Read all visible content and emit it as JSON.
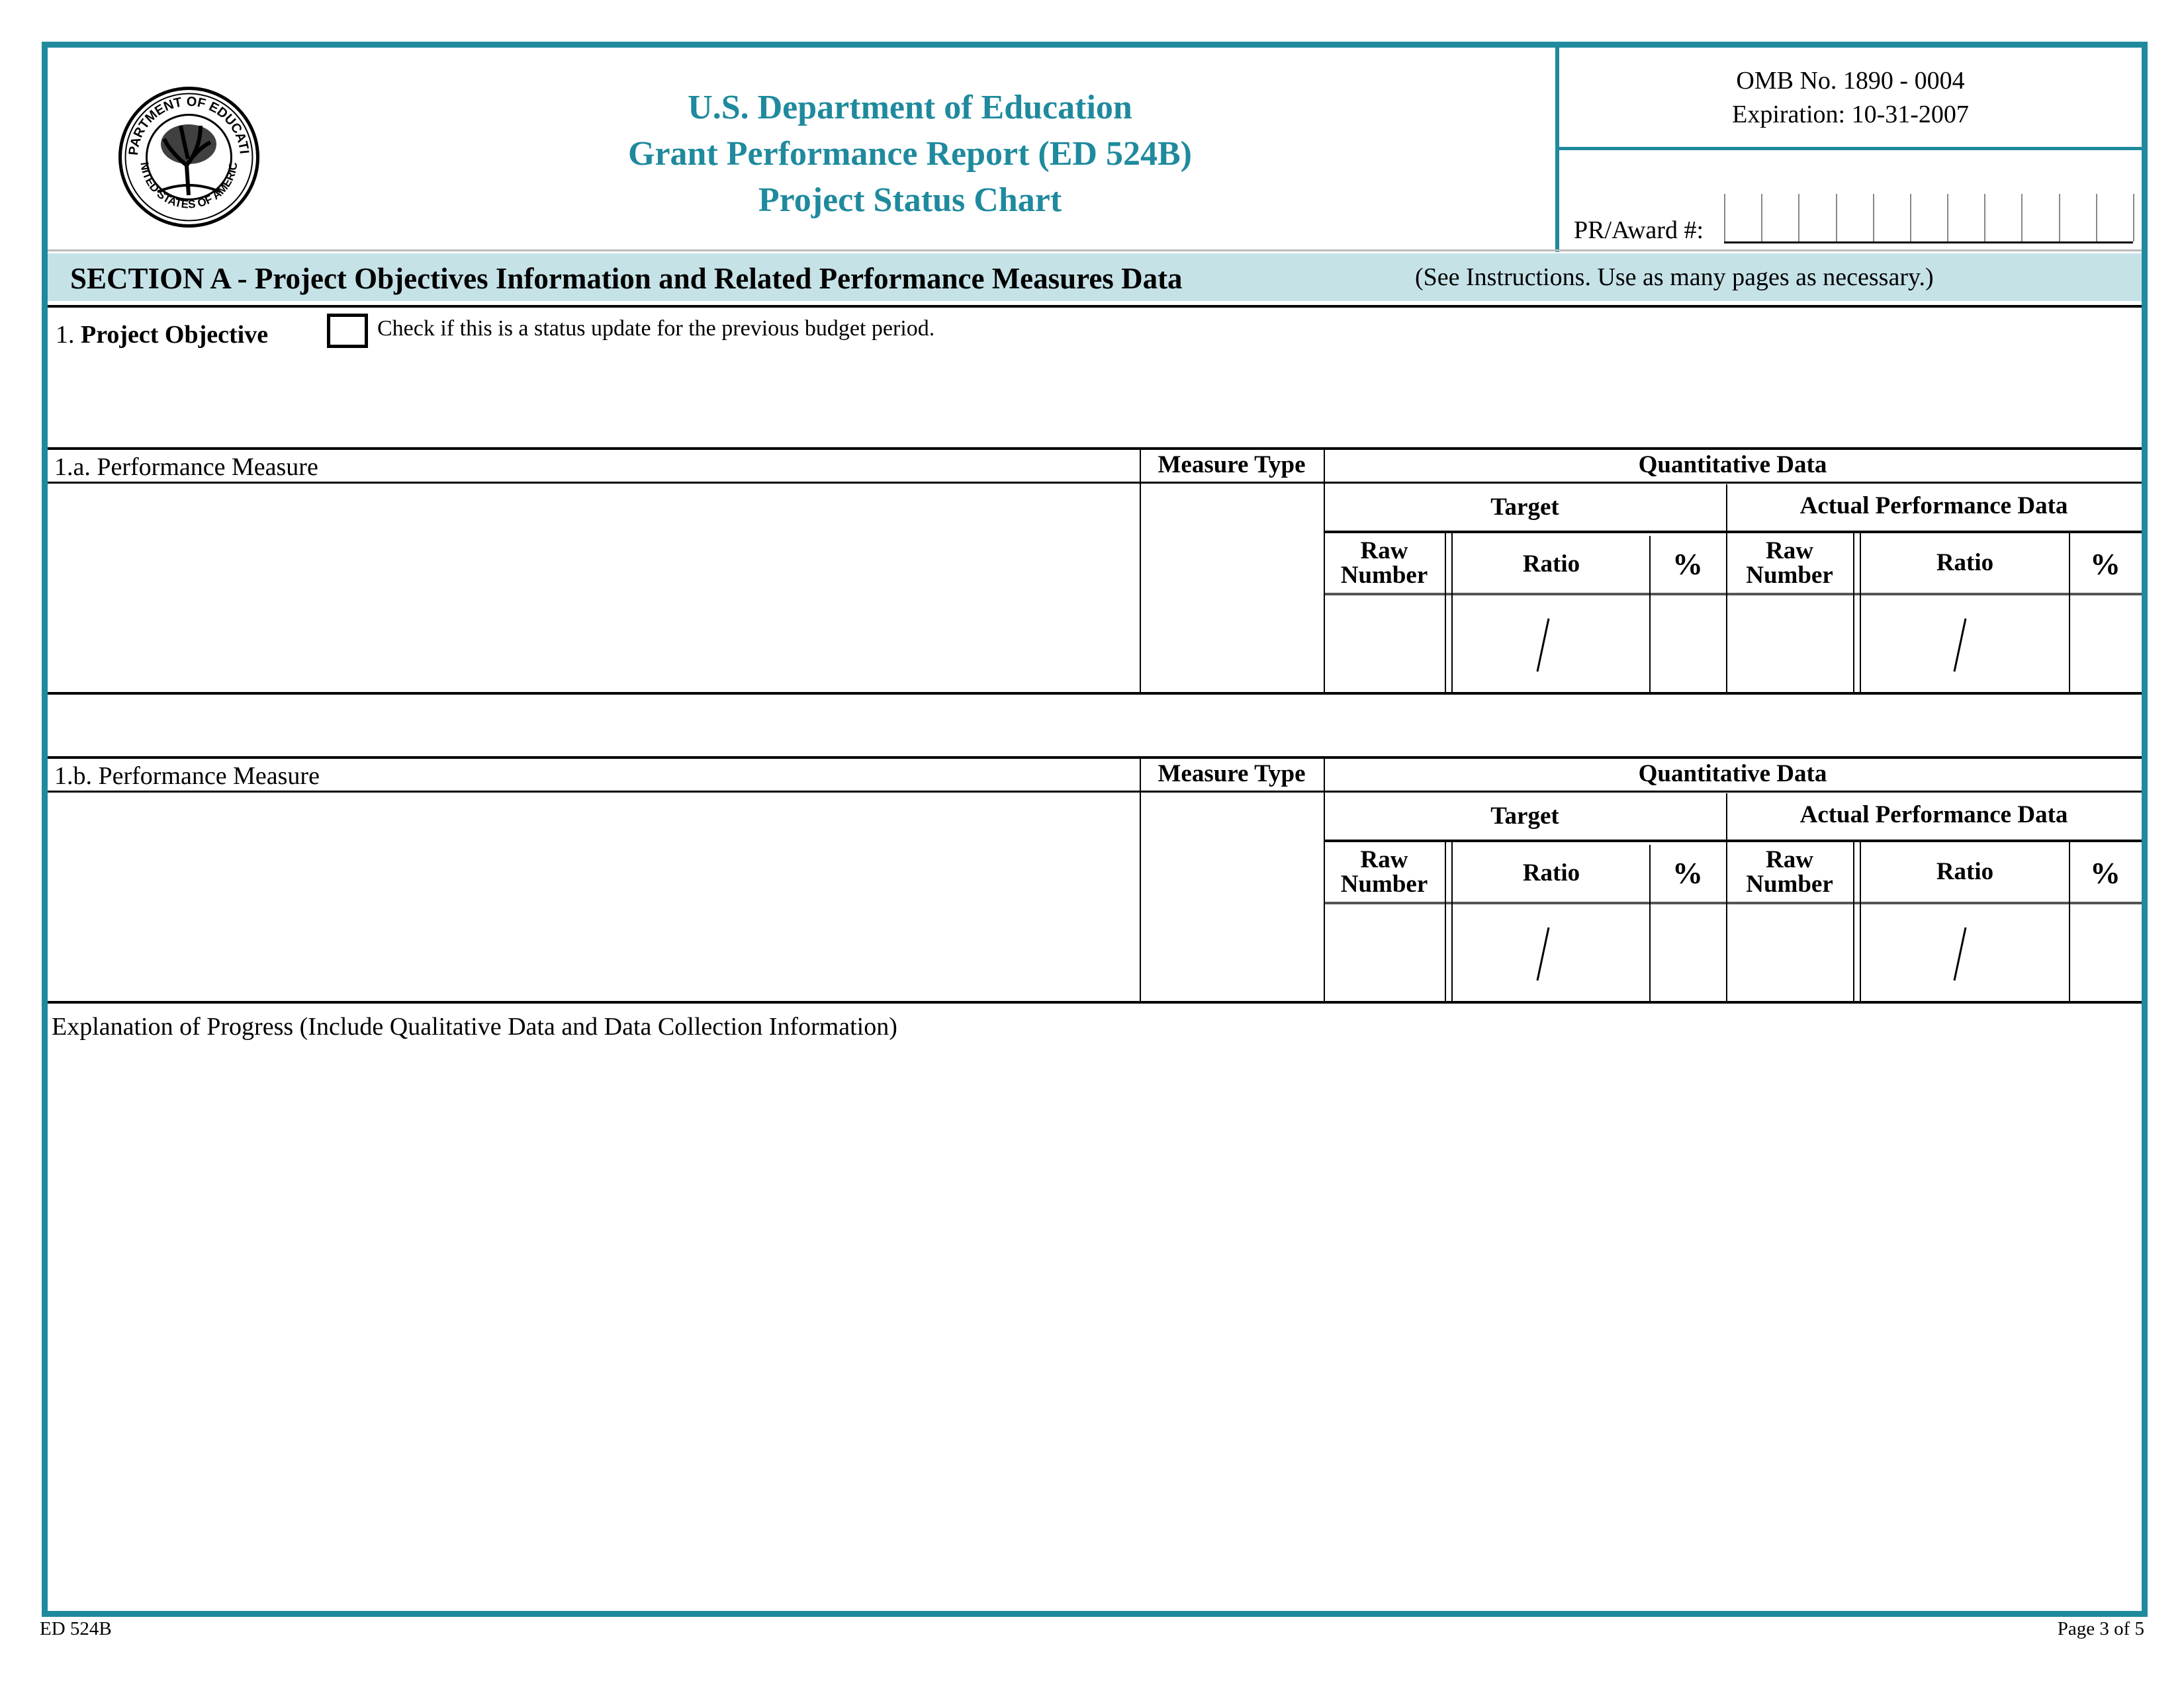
{
  "header": {
    "agency": "U.S. Department of Education",
    "report_title": "Grant Performance Report (ED 524B)",
    "chart_title": "Project Status Chart",
    "seal_icon": "department-of-education-seal",
    "omb_number": "OMB No. 1890 - 0004",
    "expiration": "Expiration: 10-31-2007",
    "award_label": "PR/Award #:",
    "award_cells": 11,
    "award_value": ""
  },
  "section_a": {
    "title": "SECTION A - Project Objectives Information and Related Performance Measures Data",
    "note": "(See Instructions.  Use as many pages as necessary.)"
  },
  "objective": {
    "number": "1.",
    "label": "Project Objective",
    "checkbox_label": "Check if this is a status update for the previous budget period.",
    "checked": false,
    "value": ""
  },
  "measures": [
    {
      "label": "1.a. Performance Measure",
      "measure_type_header": "Measure Type",
      "quantitative_header": "Quantitative Data",
      "target_header": "Target",
      "actual_header": "Actual Performance Data",
      "columns": [
        "Raw Number",
        "Ratio",
        "%",
        "Raw Number",
        "Ratio",
        "%"
      ],
      "ratio_separator": "/",
      "values": {
        "measure": "",
        "measure_type": "",
        "target_raw": "",
        "target_ratio_num": "",
        "target_ratio_den": "",
        "target_pct": "",
        "actual_raw": "",
        "actual_ratio_num": "",
        "actual_ratio_den": "",
        "actual_pct": ""
      }
    },
    {
      "label": "1.b. Performance Measure",
      "measure_type_header": "Measure Type",
      "quantitative_header": "Quantitative Data",
      "target_header": "Target",
      "actual_header": "Actual Performance Data",
      "columns": [
        "Raw Number",
        "Ratio",
        "%",
        "Raw Number",
        "Ratio",
        "%"
      ],
      "ratio_separator": "/",
      "values": {
        "measure": "",
        "measure_type": "",
        "target_raw": "",
        "target_ratio_num": "",
        "target_ratio_den": "",
        "target_pct": "",
        "actual_raw": "",
        "actual_ratio_num": "",
        "actual_ratio_den": "",
        "actual_pct": ""
      }
    }
  ],
  "explanation": {
    "label": "Explanation of Progress (Include Qualitative Data and Data Collection Information)",
    "value": ""
  },
  "footer": {
    "form_id": "ED 524B",
    "page": "Page 3 of 5"
  },
  "colors": {
    "frame": "#1f8a9d",
    "section_bar": "#c5e2e7",
    "title_text": "#1f8a9d"
  }
}
